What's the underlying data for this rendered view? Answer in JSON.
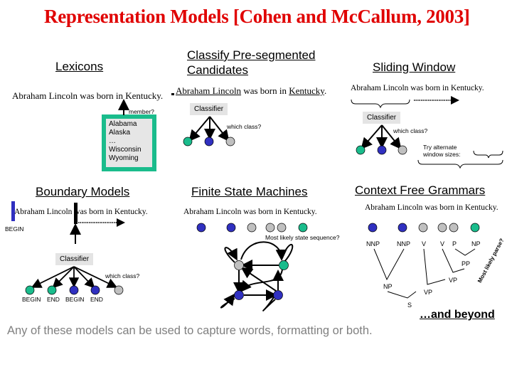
{
  "title": "Representation Models [Cohen and McCallum, 2003]",
  "sentence": "Abraham Lincoln was born in Kentucky.",
  "colors": {
    "title": "#e00000",
    "teal": "#1abc8c",
    "blue": "#3030c0",
    "gray": "#c0c0c0",
    "footer": "#808080"
  },
  "lexicons": {
    "heading": "Lexicons",
    "sentence": "Abraham Lincoln was born in Kentucky.",
    "query": "member?",
    "list": [
      "Alabama",
      "Alaska",
      "…",
      "Wisconsin",
      "Wyoming"
    ]
  },
  "classify": {
    "heading_line1": "Classify Pre-segmented",
    "heading_line2": "Candidates",
    "sentence_parts": [
      "Abraham Lincoln",
      " was born in ",
      "Kentucky",
      "."
    ],
    "classifier": "Classifier",
    "query": "which class?"
  },
  "sliding": {
    "heading": "Sliding Window",
    "sentence": "Abraham Lincoln was born in Kentucky.",
    "classifier": "Classifier",
    "query": "which class?",
    "note_line1": "Try alternate",
    "note_line2": "window sizes:"
  },
  "boundary": {
    "heading": "Boundary Models",
    "sentence": "Abraham Lincoln was born in Kentucky.",
    "begin_marker": "BEGIN",
    "classifier": "Classifier",
    "query": "which class?",
    "labels": [
      "BEGIN",
      "END",
      "BEGIN",
      "END"
    ]
  },
  "fsm": {
    "heading": "Finite State Machines",
    "sentence": "Abraham Lincoln was born in Kentucky.",
    "query": "Most likely state sequence?"
  },
  "cfg": {
    "heading": "Context Free Grammars",
    "sentence": "Abraham Lincoln was born in Kentucky.",
    "tags": [
      "NNP",
      "NNP",
      "V",
      "V",
      "P",
      "NP"
    ],
    "nodes": {
      "pp": "PP",
      "vp1": "VP",
      "np": "NP",
      "vp2": "VP",
      "s": "S"
    },
    "query": "Most likely parse?"
  },
  "beyond": "…and beyond",
  "footer": "Any of these models can be used to capture words, formatting or both."
}
